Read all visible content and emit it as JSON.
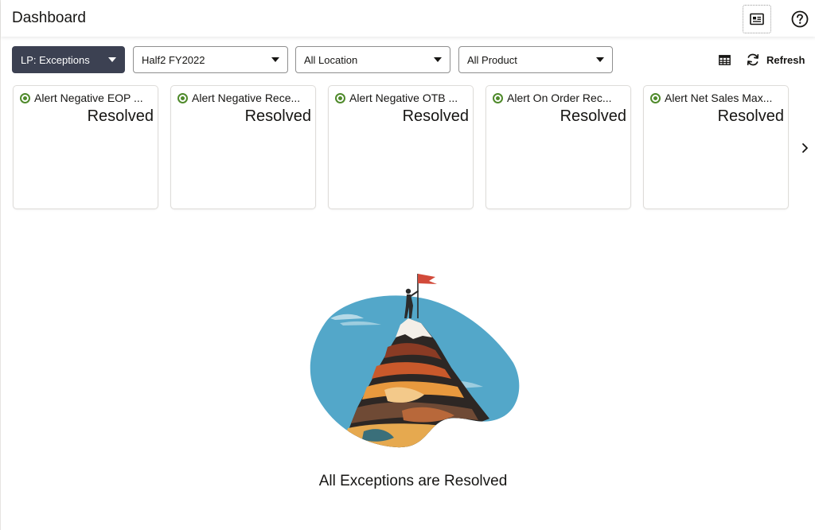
{
  "header": {
    "title": "Dashboard",
    "details_icon": "details-card-icon",
    "help_icon": "help-circle-icon"
  },
  "filters": {
    "dashboard_select": "LP: Exceptions",
    "period_select": "Half2 FY2022",
    "location_select": "All Location",
    "product_select": "All Product"
  },
  "toolbar": {
    "table_view_icon": "table-grid-icon",
    "refresh_label": "Refresh"
  },
  "tiles": [
    {
      "name": "Alert Negative EOP ...",
      "status": "Resolved"
    },
    {
      "name": "Alert Negative Rece...",
      "status": "Resolved"
    },
    {
      "name": "Alert Negative OTB ...",
      "status": "Resolved"
    },
    {
      "name": "Alert On Order Rec...",
      "status": "Resolved"
    },
    {
      "name": "Alert Net Sales Max...",
      "status": "Resolved"
    }
  ],
  "colors": {
    "primary_dropdown": "#3c4152",
    "resolved_green": "#4f8a2b"
  },
  "empty_state": {
    "message": "All Exceptions are Resolved",
    "illustration": "mountain-summit-flag-illustration"
  }
}
